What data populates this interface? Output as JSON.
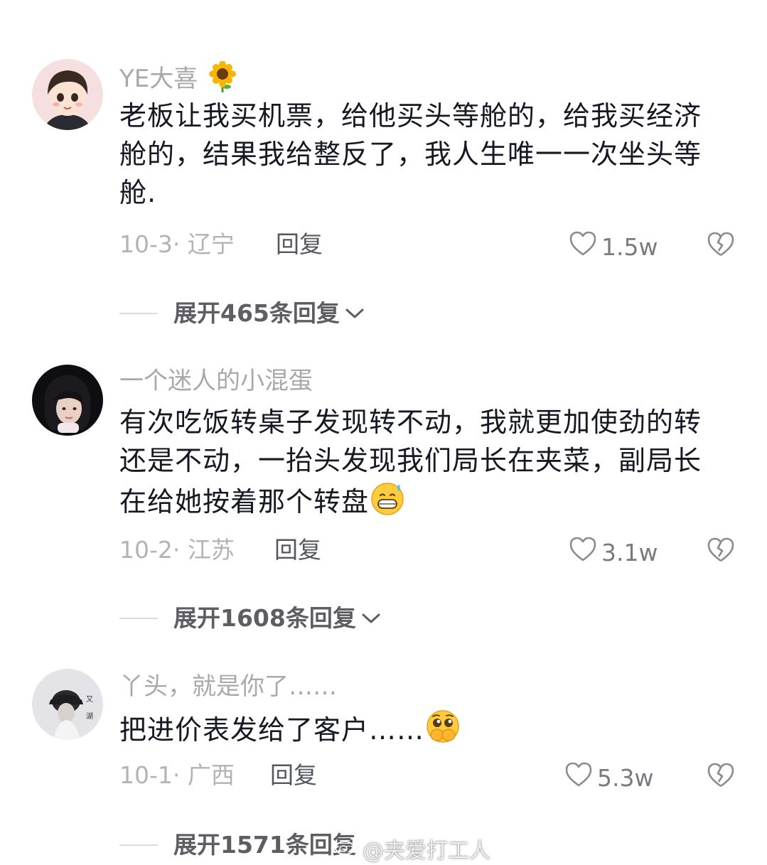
{
  "comments": [
    {
      "username": "YE大喜",
      "username_emoji": "sunflower-emoji",
      "text": "老板让我买机票，给他买头等舱的，给我买经济舱的，结果我给整反了，我人生唯一一次坐头等舱.",
      "date_location": "10-3· 辽宁",
      "reply_label": "回复",
      "likes": "1.5w",
      "expand_label": "展开465条回复"
    },
    {
      "username": "一个迷人的小混蛋",
      "text": "有次吃饭转桌子发现转不动，我就更加使劲的转还是不动，一抬头发现我们局长在夹菜，副局长在给她按着那个转盘",
      "text_emoji": "grin-sweat-emoji",
      "date_location": "10-2· 江苏",
      "reply_label": "回复",
      "likes": "3.1w",
      "expand_label": "展开1608条回复"
    },
    {
      "username": "丫头，就是你了……",
      "text": "把进价表发给了客户……",
      "text_emoji": "pleading-hands-over-mouth-emoji",
      "date_location": "10-1· 广西",
      "reply_label": "回复",
      "likes": "5.3w",
      "expand_label": "展开1571条回复"
    }
  ],
  "watermark": {
    "text": "@夹爱打工人",
    "icon": "weibo-icon"
  },
  "colors": {
    "text_primary": "#161823",
    "text_secondary": "#a9a9ad",
    "icon_gray": "#8a8b90"
  }
}
